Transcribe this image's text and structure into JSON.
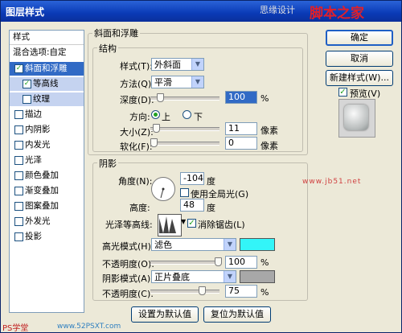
{
  "window": {
    "title": "图层样式",
    "watermark_text": "思缘设计",
    "watermark_logo": "脚本之家",
    "watermark_url": "www.jb51.net",
    "footer_left": "PS学堂",
    "footer_right": "www.52PSXT.com"
  },
  "left": {
    "header": "样式",
    "blend_options": "混合选项:自定",
    "items": [
      {
        "label": "斜面和浮雕",
        "checked": true,
        "state": "selected"
      },
      {
        "label": "等高线",
        "checked": true,
        "state": "sub"
      },
      {
        "label": "纹理",
        "checked": false,
        "state": "sub"
      },
      {
        "label": "描边",
        "checked": false
      },
      {
        "label": "内阴影",
        "checked": false
      },
      {
        "label": "内发光",
        "checked": false
      },
      {
        "label": "光泽",
        "checked": false
      },
      {
        "label": "颜色叠加",
        "checked": false
      },
      {
        "label": "渐变叠加",
        "checked": false
      },
      {
        "label": "图案叠加",
        "checked": false
      },
      {
        "label": "外发光",
        "checked": false
      },
      {
        "label": "投影",
        "checked": false
      }
    ]
  },
  "bevel": {
    "section_title": "斜面和浮雕",
    "structure_title": "结构",
    "style_label": "样式(T):",
    "style_value": "外斜面",
    "technique_label": "方法(Q):",
    "technique_value": "平滑",
    "depth_label": "深度(D):",
    "depth_value": "100",
    "depth_unit": "%",
    "direction_label": "方向:",
    "dir_up": "上",
    "dir_down": "下",
    "size_label": "大小(Z):",
    "size_value": "11",
    "size_unit": "像素",
    "soften_label": "软化(F):",
    "soften_value": "0",
    "soften_unit": "像素"
  },
  "shading": {
    "title": "阴影",
    "angle_label": "角度(N):",
    "angle_value": "-104",
    "angle_unit": "度",
    "global_light_label": "使用全局光(G)",
    "altitude_label": "高度:",
    "altitude_value": "48",
    "altitude_unit": "度",
    "gloss_label": "光泽等高线:",
    "antialias_label": "消除锯齿(L)",
    "highlight_mode_label": "高光模式(H):",
    "highlight_mode_value": "滤色",
    "highlight_color": "#33f5f8",
    "highlight_opacity_label": "不透明度(O):",
    "highlight_opacity_value": "100",
    "shadow_mode_label": "阴影模式(A):",
    "shadow_mode_value": "正片叠底",
    "shadow_color": "#a8a8a8",
    "shadow_opacity_label": "不透明度(C):",
    "shadow_opacity_value": "75",
    "percent": "%"
  },
  "bottom_buttons": {
    "set_default": "设置为默认值",
    "reset_default": "复位为默认值"
  },
  "right": {
    "ok": "确定",
    "cancel": "取消",
    "new_style": "新建样式(W)...",
    "preview_label": "预览(V)"
  }
}
